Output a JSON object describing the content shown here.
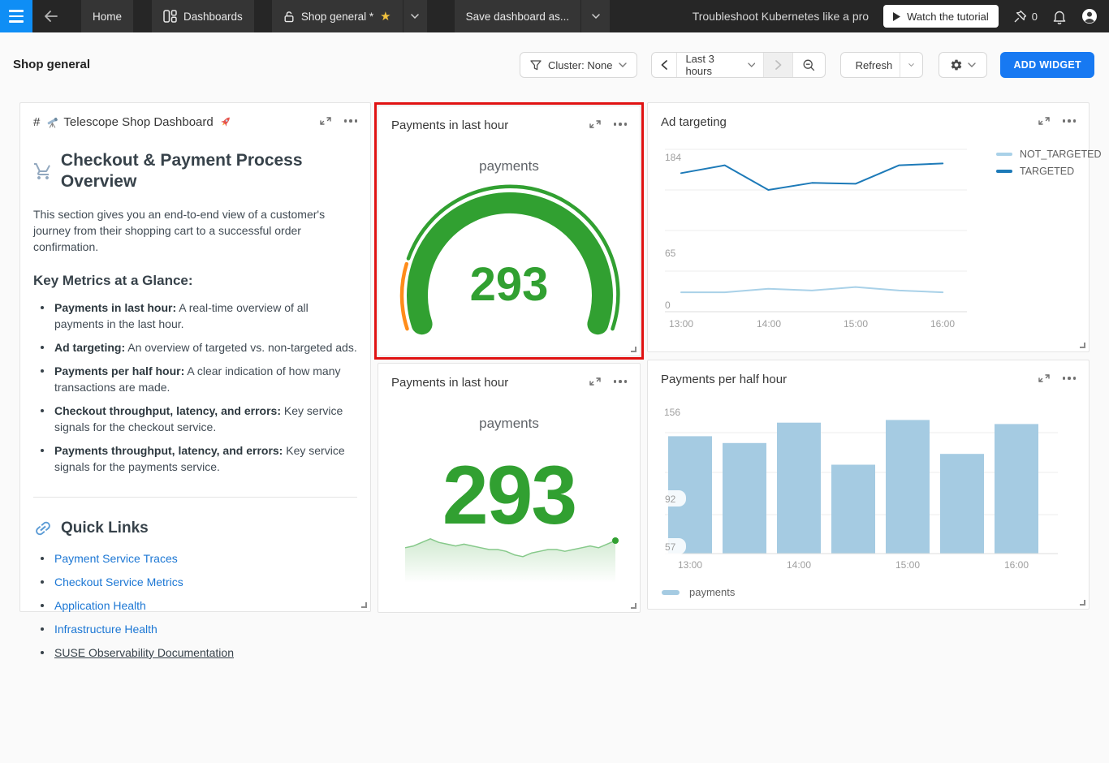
{
  "nav": {
    "home": "Home",
    "dashboards": "Dashboards",
    "current_dashboard": "Shop general *",
    "save_dashboard": "Save dashboard as...",
    "banner": "Troubleshoot Kubernetes like a pro",
    "watch_tutorial": "Watch the tutorial",
    "pin_count": "0"
  },
  "header": {
    "title": "Shop general",
    "cluster_filter": "Cluster: None",
    "time_range": "Last 3 hours",
    "refresh": "Refresh",
    "add_widget": "ADD WIDGET"
  },
  "markdown_widget": {
    "title_prefix": "#",
    "title": "Telescope Shop Dashboard",
    "heading": "Checkout & Payment Process Overview",
    "intro": "This section gives you an end-to-end view of a customer's journey from their shopping cart to a successful order confirmation.",
    "metrics_heading": "Key Metrics at a Glance:",
    "metrics": [
      {
        "term": "Payments in last hour:",
        "desc": " A real-time overview of all payments in the last hour."
      },
      {
        "term": "Ad targeting:",
        "desc": " An overview of targeted vs. non-targeted ads."
      },
      {
        "term": "Payments per half hour:",
        "desc": " A clear indication of how many transactions are made."
      },
      {
        "term": "Checkout throughput, latency, and errors:",
        "desc": " Key service signals for the checkout service."
      },
      {
        "term": "Payments throughput, latency, and errors:",
        "desc": " Key service signals for the payments service."
      }
    ],
    "quick_links_heading": "Quick Links",
    "links": [
      {
        "label": "Payment Service Traces"
      },
      {
        "label": "Checkout Service Metrics"
      },
      {
        "label": "Application Health"
      },
      {
        "label": "Infrastructure Health"
      }
    ],
    "doc_link": "SUSE Observability Documentation"
  },
  "chart_data": [
    {
      "id": "payments_gauge",
      "type": "gauge",
      "title": "Payments in last hour",
      "series_label": "payments",
      "value": 293,
      "color": "#31a031",
      "threshold_color": "#ff8c1a"
    },
    {
      "id": "ad_targeting",
      "type": "line",
      "title": "Ad targeting",
      "x": [
        "13:00",
        "13:30",
        "14:00",
        "14:30",
        "15:00",
        "15:30",
        "16:00"
      ],
      "x_tick_labels": [
        "13:00",
        "14:00",
        "15:00",
        "16:00"
      ],
      "y_ticks": [
        "184",
        "65",
        "0"
      ],
      "ylim": [
        0,
        184
      ],
      "grid": true,
      "legend_position": "right",
      "series": [
        {
          "name": "NOT_TARGETED",
          "color": "#a9d1e8",
          "values": [
            22,
            22,
            26,
            24,
            28,
            24,
            22
          ]
        },
        {
          "name": "TARGETED",
          "color": "#1d7ab8",
          "values": [
            157,
            166,
            138,
            146,
            145,
            166,
            168
          ]
        }
      ]
    },
    {
      "id": "payments_last_hour",
      "type": "area",
      "title": "Payments in last hour",
      "series_label": "payments",
      "value": 293,
      "color": "#31a031",
      "line_color": "#86c98a",
      "trend": [
        289,
        290,
        292,
        294,
        292,
        291,
        290,
        291,
        290,
        289,
        288,
        288,
        287,
        285,
        284,
        286,
        287,
        288,
        288,
        287,
        288,
        289,
        290,
        289,
        291,
        293
      ]
    },
    {
      "id": "payments_per_half_hour",
      "type": "bar",
      "title": "Payments per half hour",
      "categories": [
        "13:00",
        "13:30",
        "14:00",
        "14:30",
        "15:00",
        "15:30",
        "16:00"
      ],
      "x_tick_labels": [
        "13:00",
        "14:00",
        "15:00",
        "16:00"
      ],
      "y_ticks": [
        "156",
        "92",
        "57"
      ],
      "values": [
        139,
        134,
        149,
        118,
        151,
        126,
        148
      ],
      "color": "#a5cbe2",
      "legend": [
        "payments"
      ]
    }
  ],
  "colors": {
    "accent_blue": "#1779f2",
    "hamburger_blue": "#0f8ef5",
    "gauge_green": "#31a031",
    "gauge_orange": "#ff8c1a",
    "bar_blue": "#a5cbe2",
    "targeted_blue": "#1d7ab8",
    "not_targeted_blue": "#a9d1e8",
    "link_blue": "#1c77d4",
    "star_gold": "#f2c23e",
    "highlight_red": "#e01212"
  }
}
